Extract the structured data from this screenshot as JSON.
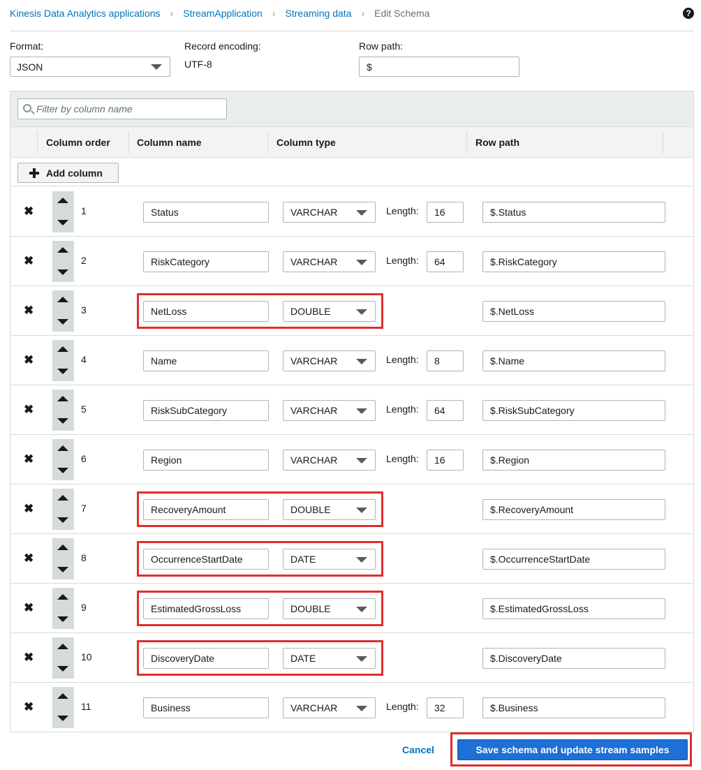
{
  "breadcrumb": {
    "items": [
      "Kinesis Data Analytics applications",
      "StreamApplication",
      "Streaming data"
    ],
    "current": "Edit Schema",
    "help_icon": "?"
  },
  "format": {
    "format_label": "Format:",
    "format_value": "JSON",
    "encoding_label": "Record encoding:",
    "encoding_value": "UTF-8",
    "rowpath_label": "Row path:",
    "rowpath_value": "$"
  },
  "table": {
    "filter_placeholder": "Filter by column name",
    "headers": {
      "order": "Column order",
      "name": "Column name",
      "type": "Column type",
      "path": "Row path"
    },
    "add_column_label": "Add column",
    "length_label": "Length:",
    "highlight_color": "#e02d2d",
    "rows": [
      {
        "order": "1",
        "name": "Status",
        "type": "VARCHAR",
        "length": "16",
        "path": "$.Status",
        "highlighted": false
      },
      {
        "order": "2",
        "name": "RiskCategory",
        "type": "VARCHAR",
        "length": "64",
        "path": "$.RiskCategory",
        "highlighted": false
      },
      {
        "order": "3",
        "name": "NetLoss",
        "type": "DOUBLE",
        "length": null,
        "path": "$.NetLoss",
        "highlighted": true
      },
      {
        "order": "4",
        "name": "Name",
        "type": "VARCHAR",
        "length": "8",
        "path": "$.Name",
        "highlighted": false
      },
      {
        "order": "5",
        "name": "RiskSubCategory",
        "type": "VARCHAR",
        "length": "64",
        "path": "$.RiskSubCategory",
        "highlighted": false
      },
      {
        "order": "6",
        "name": "Region",
        "type": "VARCHAR",
        "length": "16",
        "path": "$.Region",
        "highlighted": false
      },
      {
        "order": "7",
        "name": "RecoveryAmount",
        "type": "DOUBLE",
        "length": null,
        "path": "$.RecoveryAmount",
        "highlighted": true
      },
      {
        "order": "8",
        "name": "OccurrenceStartDate",
        "type": "DATE",
        "length": null,
        "path": "$.OccurrenceStartDate",
        "highlighted": true
      },
      {
        "order": "9",
        "name": "EstimatedGrossLoss",
        "type": "DOUBLE",
        "length": null,
        "path": "$.EstimatedGrossLoss",
        "highlighted": true
      },
      {
        "order": "10",
        "name": "DiscoveryDate",
        "type": "DATE",
        "length": null,
        "path": "$.DiscoveryDate",
        "highlighted": true
      },
      {
        "order": "11",
        "name": "Business",
        "type": "VARCHAR",
        "length": "32",
        "path": "$.Business",
        "highlighted": false
      }
    ]
  },
  "footer": {
    "cancel_label": "Cancel",
    "save_label": "Save schema and update stream samples",
    "save_color": "#1e6fd6"
  }
}
